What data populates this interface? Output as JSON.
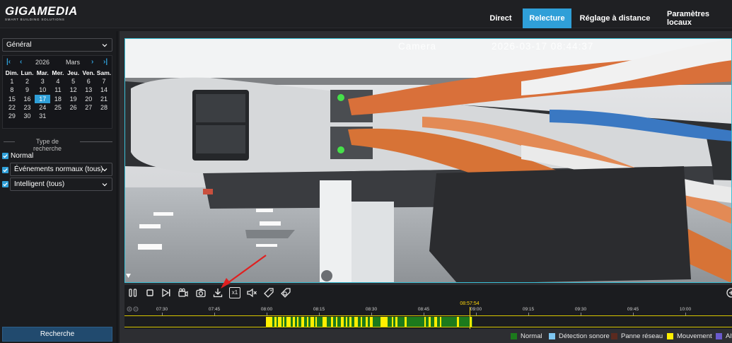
{
  "header": {
    "logo_text": "GIGAMEDIA",
    "logo_tagline": "SMART BUILDING SOLUTIONS",
    "nav": [
      {
        "label": "Direct",
        "active": false
      },
      {
        "label": "Relecture",
        "active": true
      },
      {
        "label": "Réglage à distance",
        "active": false
      },
      {
        "label": "Paramètres locaux",
        "active": false
      }
    ]
  },
  "sidebar": {
    "channel_select": "Général",
    "calendar": {
      "year": "2026",
      "month": "Mars",
      "weekdays": [
        "Dim.",
        "Lun.",
        "Mar.",
        "Mer.",
        "Jeu.",
        "Ven.",
        "Sam."
      ],
      "weeks": [
        [
          "1",
          "2",
          "3",
          "4",
          "5",
          "6",
          "7"
        ],
        [
          "8",
          "9",
          "10",
          "11",
          "12",
          "13",
          "14"
        ],
        [
          "15",
          "16",
          "17",
          "18",
          "19",
          "20",
          "21"
        ],
        [
          "22",
          "23",
          "24",
          "25",
          "26",
          "27",
          "28"
        ],
        [
          "29",
          "30",
          "31",
          "",
          "",
          "",
          ""
        ]
      ],
      "selected_day": "17",
      "icons": {
        "first": "double-chevron-left-icon",
        "prev": "chevron-left-icon",
        "next": "chevron-right-icon",
        "last": "double-chevron-right-icon"
      }
    },
    "search_type_title": "Type de recherche",
    "options": [
      {
        "label": "Normal",
        "checked": true,
        "dropdown": false
      },
      {
        "label": "Événements normaux (tous)",
        "checked": true,
        "dropdown": true
      },
      {
        "label": "Intelligent (tous)",
        "checked": true,
        "dropdown": true
      }
    ],
    "search_button": "Recherche"
  },
  "video": {
    "osd_name": "Camera",
    "osd_time": "2026-03-17 08:44:37"
  },
  "controls": {
    "icons": [
      "pause-icon",
      "stop-icon",
      "next-frame-icon",
      "record-clip-icon",
      "snapshot-icon",
      "download-icon",
      "speed-x1-icon",
      "mute-icon",
      "tag-icon",
      "tag-search-icon"
    ],
    "speed_label": "x1",
    "right_icon": "zoom-in-icon"
  },
  "timeline": {
    "current_time": "08:57:54",
    "ticks": [
      "07:30",
      "07:45",
      "08:00",
      "08:15",
      "08:30",
      "08:45",
      "09:00",
      "09:15",
      "09:30",
      "09:45",
      "10:00"
    ]
  },
  "legend": [
    {
      "label": "Normal",
      "color": "#1c7a1c"
    },
    {
      "label": "Détection sonore",
      "color": "#7ec6f0"
    },
    {
      "label": "Panne réseau",
      "color": "#5b2a1f"
    },
    {
      "label": "Mouvement",
      "color": "#ffef00"
    },
    {
      "label": "Alt",
      "color": "#6a5acd"
    }
  ]
}
